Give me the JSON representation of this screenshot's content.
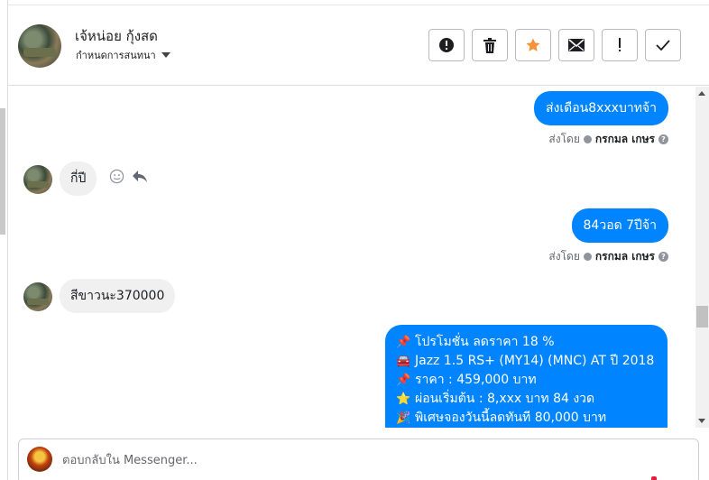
{
  "header": {
    "contact_name": "เจ้หน่อย กุ้งสด",
    "contact_sub": "กำหนดการสนทนา",
    "actions": [
      {
        "name": "report-button",
        "icon": "exclamation-circle-icon"
      },
      {
        "name": "delete-button",
        "icon": "trash-icon"
      },
      {
        "name": "star-button",
        "icon": "star-icon"
      },
      {
        "name": "mark-unread-button",
        "icon": "envelope-icon"
      },
      {
        "name": "important-button",
        "icon": "exclamation-icon"
      },
      {
        "name": "done-button",
        "icon": "checkmark-icon"
      }
    ]
  },
  "messages": [
    {
      "direction": "out",
      "text": "ส่งเดือน8xxxบาทจ้า",
      "sent_by_label": "ส่งโดย",
      "sender": "กรกมล เกษร"
    },
    {
      "direction": "in",
      "text": "กี่ปี"
    },
    {
      "direction": "out",
      "text": "84วอด 7ปีจ้า",
      "sent_by_label": "ส่งโดย",
      "sender": "กรกมล เกษร"
    },
    {
      "direction": "in",
      "text": "สีขาวนะ370000"
    }
  ],
  "promo": {
    "lines": [
      {
        "emoji": "pushpin",
        "text": "โปรโมชั่น ลดราคา 18 %"
      },
      {
        "emoji": "car",
        "text": "Jazz 1.5 RS+ (MY14) (MNC) AT ปี 2018"
      },
      {
        "emoji": "pushpin",
        "text": "ราคา : 459,000 บาท"
      },
      {
        "emoji": "star",
        "text": "ผ่อนเริ่มต้น : 8,xxx บาท 84 งวด"
      },
      {
        "emoji": "party-popper",
        "text": "พิเศษจองวันนี้ลดทันที 80,000 บาท"
      }
    ]
  },
  "composer": {
    "placeholder": "ตอบกลับใน Messenger..."
  },
  "colors": {
    "accent": "#0084ff",
    "incoming_bubble": "#f0f0f0",
    "star": "#f7923a"
  }
}
